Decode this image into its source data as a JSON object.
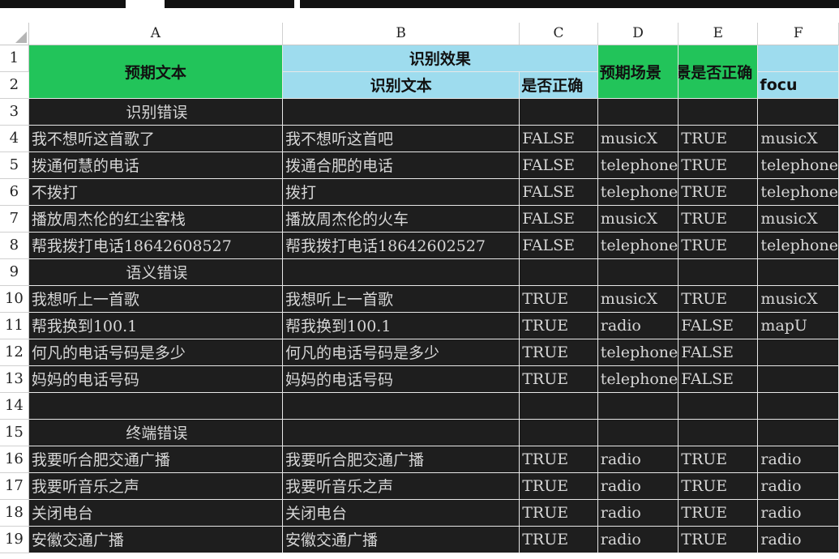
{
  "colors": {
    "header_green": "#22c45a",
    "header_blue": "#9edcee",
    "cell_dark": "#1e1e1e",
    "cell_text": "#d6d6d6"
  },
  "columns": [
    "A",
    "B",
    "C",
    "D",
    "E",
    "F"
  ],
  "header": {
    "expected_text": "预期文本",
    "recognition_effect": "识别效果",
    "recognized_text": "识别文本",
    "is_correct": "是否正确",
    "expected_scene": "预期场景",
    "scene_is_correct": "景是否正确",
    "focus": "focu"
  },
  "rows": [
    {
      "num": "3",
      "section": "识别错误"
    },
    {
      "num": "4",
      "cells": [
        "我不想听这首歌了",
        "我不想听这首吧",
        "FALSE",
        "musicX",
        "TRUE",
        "musicX"
      ]
    },
    {
      "num": "5",
      "cells": [
        "拨通何慧的电话",
        "拨通合肥的电话",
        "FALSE",
        "telephone",
        "TRUE",
        "telephone"
      ]
    },
    {
      "num": "6",
      "cells": [
        "不拨打",
        "拨打",
        "FALSE",
        "telephone",
        "TRUE",
        "telephone"
      ]
    },
    {
      "num": "7",
      "cells": [
        "播放周杰伦的红尘客栈",
        "播放周杰伦的火车",
        "FALSE",
        "musicX",
        "TRUE",
        "musicX"
      ]
    },
    {
      "num": "8",
      "cells": [
        "帮我拨打电话18642608527",
        "帮我拨打电话18642602527",
        "FALSE",
        "telephone",
        "TRUE",
        "telephone"
      ]
    },
    {
      "num": "9",
      "section": "语义错误"
    },
    {
      "num": "10",
      "cells": [
        "我想听上一首歌",
        "我想听上一首歌",
        "TRUE",
        "musicX",
        "TRUE",
        "musicX"
      ]
    },
    {
      "num": "11",
      "cells": [
        "帮我换到100.1",
        "帮我换到100.1",
        "TRUE",
        "radio",
        "FALSE",
        "mapU"
      ]
    },
    {
      "num": "12",
      "cells": [
        "何凡的电话号码是多少",
        "何凡的电话号码是多少",
        "TRUE",
        "telephone",
        "FALSE",
        ""
      ]
    },
    {
      "num": "13",
      "cells": [
        "妈妈的电话号码",
        "妈妈的电话号码",
        "TRUE",
        "telephone",
        "FALSE",
        ""
      ]
    },
    {
      "num": "14",
      "cells": [
        "",
        "",
        "",
        "",
        "",
        ""
      ]
    },
    {
      "num": "15",
      "section": "终端错误"
    },
    {
      "num": "16",
      "cells": [
        "我要听合肥交通广播",
        "我要听合肥交通广播",
        "TRUE",
        "radio",
        "TRUE",
        "radio"
      ]
    },
    {
      "num": "17",
      "cells": [
        "我要听音乐之声",
        "我要听音乐之声",
        "TRUE",
        "radio",
        "TRUE",
        "radio"
      ]
    },
    {
      "num": "18",
      "cells": [
        "关闭电台",
        "关闭电台",
        "TRUE",
        "radio",
        "TRUE",
        "radio"
      ]
    },
    {
      "num": "19",
      "cells": [
        "安徽交通广播",
        "安徽交通广播",
        "TRUE",
        "radio",
        "TRUE",
        "radio"
      ]
    }
  ]
}
